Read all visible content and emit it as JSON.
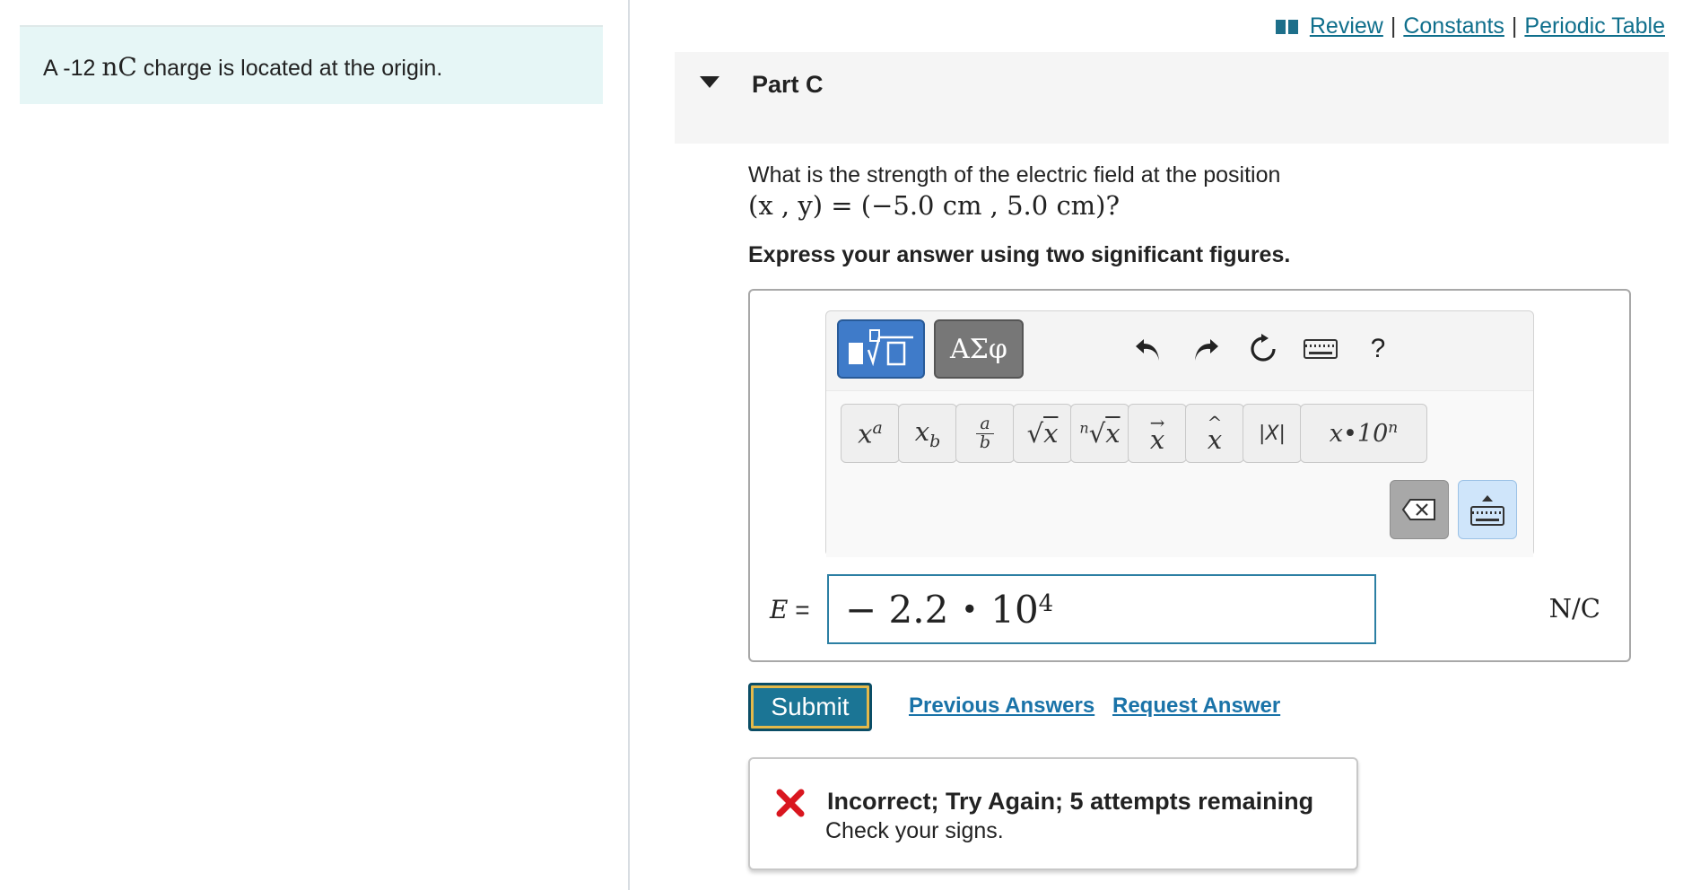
{
  "problem": {
    "statement_prefix": "A -12",
    "statement_unit": "nC",
    "statement_suffix": "charge is located at the origin."
  },
  "top_links": {
    "review": "Review",
    "constants": "Constants",
    "periodic_table": "Periodic Table",
    "separator": "|"
  },
  "part": {
    "title": "Part C"
  },
  "question": {
    "text": "What is the strength of the electric field at the position",
    "math": "(x , y)  =  (−5.0 cm , 5.0 cm)?",
    "instruction": "Express your answer using two significant figures."
  },
  "toolbar": {
    "greek_label": "ΑΣφ",
    "help_label": "?",
    "templates": [
      {
        "name": "superscript",
        "label": "xᵃ"
      },
      {
        "name": "subscript",
        "label": "x_b"
      },
      {
        "name": "fraction",
        "label": "a/b"
      },
      {
        "name": "sqrt",
        "label": "√x"
      },
      {
        "name": "nth-root",
        "label": "ⁿ√x"
      },
      {
        "name": "vector",
        "label": "x⃗"
      },
      {
        "name": "hat",
        "label": "x̂"
      },
      {
        "name": "abs",
        "label": "|X|"
      },
      {
        "name": "sci",
        "label": "x·10ⁿ"
      }
    ]
  },
  "answer": {
    "variable": "E",
    "equals": "=",
    "value_mantissa": "− 2.2",
    "value_dot": "•",
    "value_base": "10",
    "value_exponent": "4",
    "unit": "N/C"
  },
  "actions": {
    "submit_label": "Submit",
    "previous_answers": "Previous Answers",
    "request_answer": "Request Answer"
  },
  "feedback": {
    "title": "Incorrect; Try Again; 5 attempts remaining",
    "hint": "Check your signs.",
    "status_color": "#d9161f"
  },
  "colors": {
    "accent": "#1b7595",
    "link": "#0f6f8c",
    "left_panel_bg": "#e6f6f6"
  }
}
